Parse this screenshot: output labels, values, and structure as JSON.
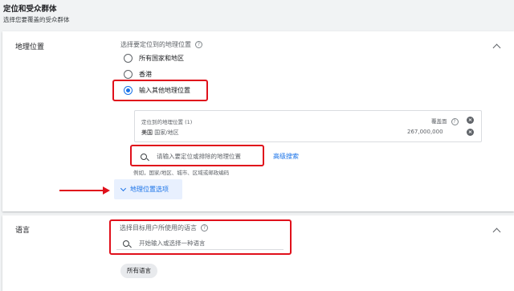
{
  "header": {
    "title": "定位和受众群体",
    "subtitle": "选择您要覆盖的受众群体"
  },
  "geo": {
    "section_label": "地理位置",
    "prompt": "选择要定位到的地理位置",
    "options": [
      "所有国家和地区",
      "香港",
      "输入其他地理位置"
    ],
    "selected_option": "输入其他地理位置",
    "targeted_title": "定位到的地理位置 (1)",
    "reach_label": "覆盖面",
    "location_name": "美国",
    "location_type": "国家/地区",
    "reach_value": "267,000,000",
    "search_placeholder": "请输入要定位或排除的地理位置",
    "advanced_search": "高级搜索",
    "hint": "例如，国家/地区、城市、区域或邮政编码",
    "options_button": "地理位置选项"
  },
  "language": {
    "section_label": "语言",
    "prompt": "选择目标用户所使用的语言",
    "search_placeholder": "开始输入或选择一种语言",
    "chip": "所有语言"
  },
  "colors": {
    "accent": "#1a73e8",
    "annotation_red": "#e0101b",
    "chip_bg": "#e8eaed"
  },
  "icons": [
    "help-icon",
    "radio-icon",
    "close-icon",
    "search-icon",
    "chevron-down-icon",
    "chevron-up-icon",
    "arrow-icon"
  ]
}
